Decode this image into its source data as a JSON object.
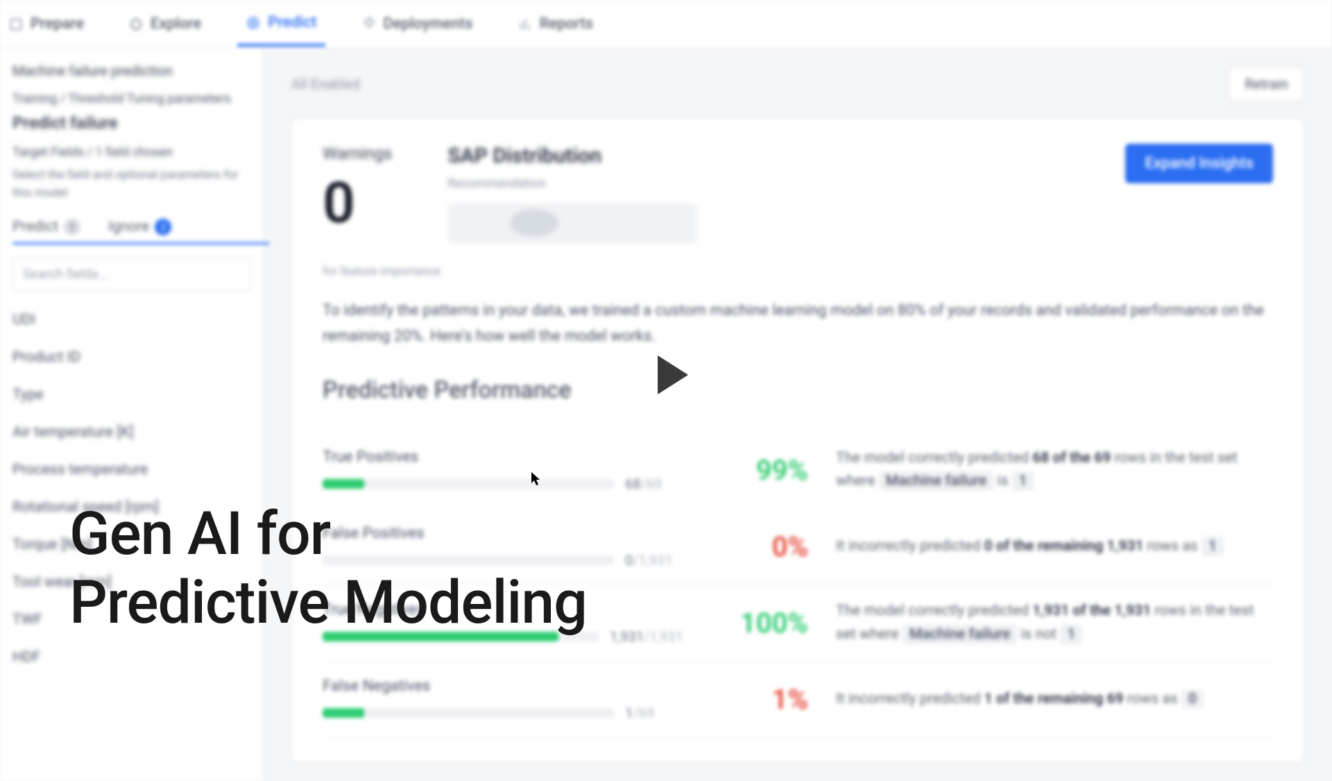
{
  "nav": {
    "prepare": "Prepare",
    "explore": "Explore",
    "predict": "Predict",
    "deployments": "Deployments",
    "reports": "Reports"
  },
  "sidebar": {
    "title": "Machine failure prediction",
    "breadcrumb": "Training / Threshold Tuning parameters",
    "heading": "Predict failure",
    "subhead": "Target Fields / 1 field chosen",
    "helper": "Select the field and optional parameters for this model",
    "tab_predict": "Predict",
    "tab_predict_count": "1",
    "tab_ignore": "Ignore",
    "tab_ignore_count": "2",
    "search_placeholder": "Search fields...",
    "fields": [
      "UDI",
      "Product ID",
      "Type",
      "Air temperature [K]",
      "Process temperature",
      "Rotational speed [rpm]",
      "Torque [Nm]",
      "Tool wear [min]",
      "TWF",
      "HDF"
    ]
  },
  "main": {
    "status": "All Enabled",
    "retrain": "Retrain",
    "metric_label": "Warnings",
    "metric_value": "0",
    "dist_title": "SAP Distribution",
    "dist_sub": "Recommendation",
    "expand": "Expand Insights",
    "footnote": "for feature importance",
    "description": "To identify the patterns in your data, we trained a custom machine learning model on 80% of your records and validated performance on the remaining 20%. Here's how well the model works.",
    "section": "Predictive Performance",
    "rows": [
      {
        "label": "True Positives",
        "count": "68",
        "total": "/69",
        "pct": "99%",
        "pct_color": "green",
        "fill": "short",
        "desc_pre": "The model correctly predicted ",
        "desc_bold": "68 of the 69",
        "desc_mid": " rows in the test set where ",
        "chip1": "Machine failure",
        "desc_join": " is ",
        "chip2": "1"
      },
      {
        "label": "False Positives",
        "count": "0",
        "total": "/1,931",
        "pct": "0%",
        "pct_color": "red",
        "fill": "empty",
        "desc_pre": "It incorrectly predicted ",
        "desc_bold": "0 of the remaining 1,931",
        "desc_mid": " rows as ",
        "chip1": "1",
        "desc_join": "",
        "chip2": ""
      },
      {
        "label": "True Negatives",
        "count": "1,931",
        "total": "/1,931",
        "pct": "100%",
        "pct_color": "green",
        "fill": "full",
        "desc_pre": "The model correctly predicted ",
        "desc_bold": "1,931 of the 1,931",
        "desc_mid": " rows in the test set where ",
        "chip1": "Machine failure",
        "desc_join": " is not ",
        "chip2": "1"
      },
      {
        "label": "False Negatives",
        "count": "1",
        "total": "/69",
        "pct": "1%",
        "pct_color": "red",
        "fill": "short",
        "desc_pre": "It incorrectly predicted ",
        "desc_bold": "1 of the remaining 69",
        "desc_mid": " rows as ",
        "chip1": "0",
        "desc_join": "",
        "chip2": ""
      }
    ]
  },
  "overlay": {
    "headline1": "Gen AI for",
    "headline2": "Predictive Modeling"
  }
}
